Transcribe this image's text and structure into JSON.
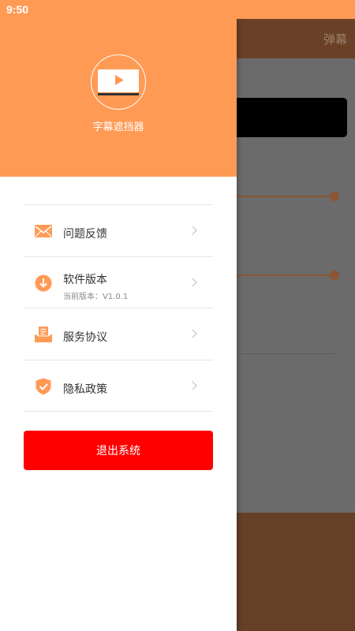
{
  "status_bar": {
    "time": "9:50"
  },
  "background": {
    "header_title": "弹幕",
    "colors": {
      "header": "#6a4127",
      "overlay": "#6b6b6b"
    }
  },
  "drawer": {
    "app_name": "字幕遮挡器",
    "logo_icon": "video-play-icon",
    "menu": [
      {
        "label": "问题反馈",
        "icon": "mail-icon"
      },
      {
        "label": "软件版本",
        "sub": "当前版本：V1.0.1",
        "icon": "download-icon"
      },
      {
        "label": "服务协议",
        "icon": "document-icon"
      },
      {
        "label": "隐私政策",
        "icon": "shield-check-icon"
      }
    ],
    "logout_label": "退出系统",
    "colors": {
      "accent": "#ff9a55",
      "logout": "#ff0000"
    }
  }
}
